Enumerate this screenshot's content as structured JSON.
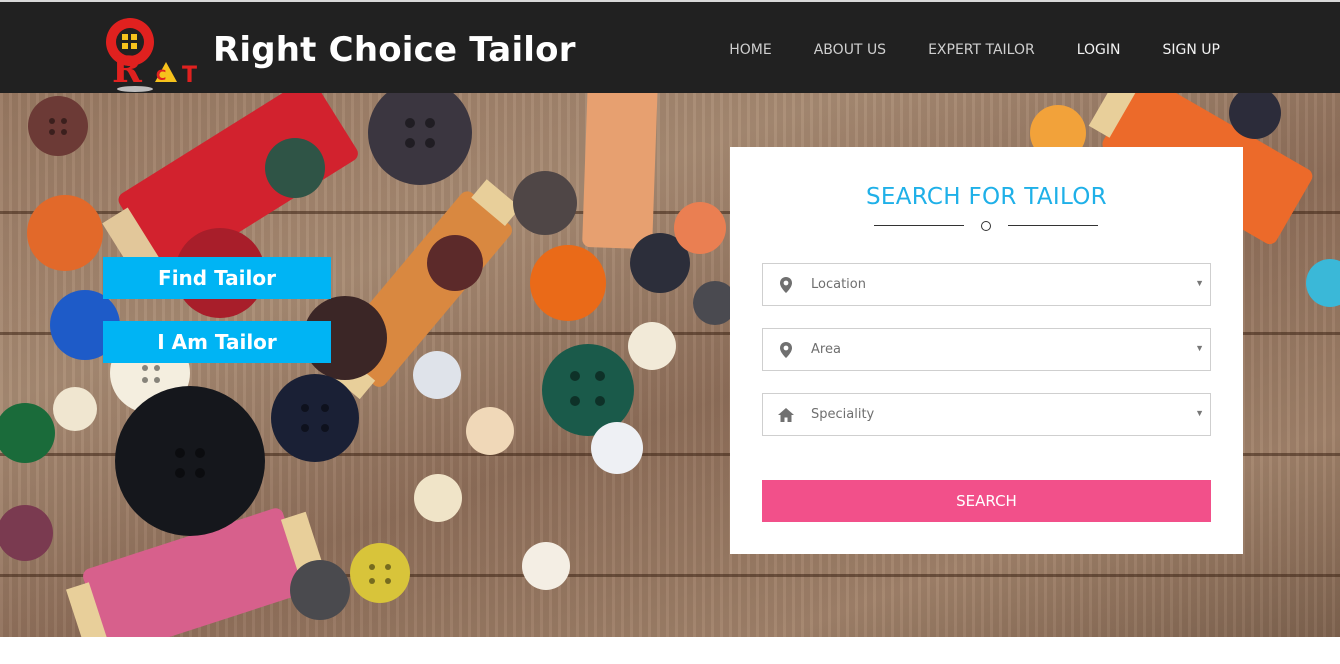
{
  "header": {
    "brand": "Right Choice Tailor",
    "logo_text": "RCT",
    "nav": [
      "HOME",
      "ABOUT US",
      "EXPERT TAILOR",
      "LOGIN",
      "SIGN UP"
    ]
  },
  "hero": {
    "find_tailor": "Find Tailor",
    "i_am_tailor": "I Am Tailor"
  },
  "search": {
    "title": "SEARCH FOR TAILOR",
    "location": "Location",
    "area": "Area",
    "speciality": "Speciality",
    "button": "SEARCH"
  },
  "icons": {
    "location": "map-pin-icon",
    "area": "map-pin-icon",
    "speciality": "home-icon",
    "caret": "caret-down-icon"
  },
  "colors": {
    "header_bg": "#212121",
    "accent_blue": "#00b4f4",
    "title_blue": "#1fb0e8",
    "search_pink": "#f2508a"
  }
}
